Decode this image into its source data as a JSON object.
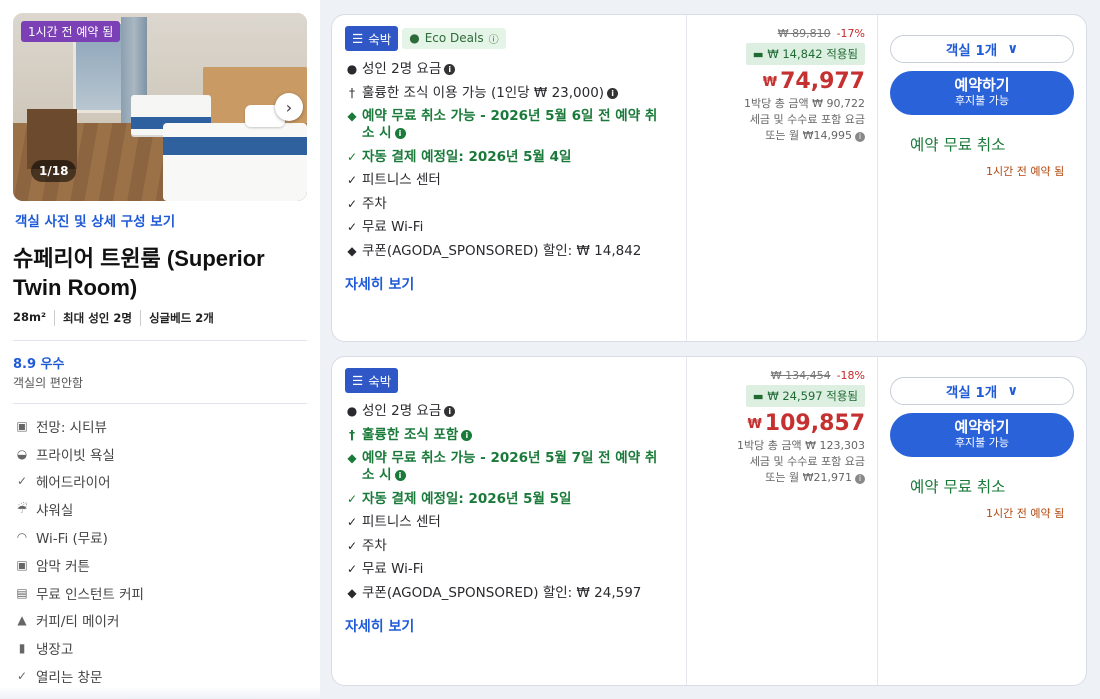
{
  "room": {
    "photo_badge": "1시간 전 예약 됨",
    "photo_counter": "1/18",
    "photo_link": "객실 사진 및 상세 구성 보기",
    "title": "슈페리어 트윈룸 (Superior Twin Room)",
    "specs": [
      "28m²",
      "최대 성인 2명",
      "싱글베드 2개"
    ],
    "rating": "8.9 우수",
    "rating_sub": "객실의 편안함",
    "amenities": [
      {
        "icon": "view-icon",
        "label": "전망: 시티뷰"
      },
      {
        "icon": "bathroom-icon",
        "label": "프라이빗 욕실"
      },
      {
        "icon": "check-icon",
        "label": "헤어드라이어"
      },
      {
        "icon": "shower-icon",
        "label": "샤워실"
      },
      {
        "icon": "wifi-icon",
        "label": "Wi-Fi (무료)"
      },
      {
        "icon": "curtain-icon",
        "label": "암막 커튼"
      },
      {
        "icon": "coffee-icon",
        "label": "무료 인스턴트 커피"
      },
      {
        "icon": "kettle-icon",
        "label": "커피/티 메이커"
      },
      {
        "icon": "fridge-icon",
        "label": "냉장고"
      },
      {
        "icon": "check-icon",
        "label": "열리는 창문"
      }
    ]
  },
  "offers": [
    {
      "tag_stay": "숙박",
      "tag_eco": "Eco Deals",
      "features": [
        {
          "icon": "person-icon",
          "text": "성인 2명 요금",
          "green": false,
          "info": true
        },
        {
          "icon": "fork-icon",
          "text": "훌륭한 조식 이용 가능 (1인당 ₩ 23,000)",
          "green": false,
          "info": true
        },
        {
          "icon": "shield-icon",
          "text": "예약 무료 취소 가능 - 2026년 5월 6일 전 예약 취소 시",
          "green": true,
          "info": true
        },
        {
          "icon": "check-icon",
          "text": "자동 결제 예정일: 2026년 5월 4일",
          "green": true,
          "info": false
        },
        {
          "icon": "check-icon",
          "text": "피트니스 센터",
          "green": false,
          "info": false
        },
        {
          "icon": "check-icon",
          "text": "주차",
          "green": false,
          "info": false
        },
        {
          "icon": "check-icon",
          "text": "무료 Wi-Fi",
          "green": false,
          "info": false
        },
        {
          "icon": "coupon-icon",
          "text": "쿠폰(AGODA_SPONSORED) 할인: ₩ 14,842",
          "green": false,
          "info": false
        }
      ],
      "more_link": "자세히 보기",
      "old_price": "₩ 89,810",
      "discount_pct": "-17%",
      "saved": "₩ 14,842 적용됨",
      "currency": "₩",
      "price": "74,977",
      "price_sub1": "1박당 총 금액 ₩ 90,722",
      "price_sub2": "세금 및 수수료 포함 요금",
      "price_sub3": "또는 월 ₩14,995",
      "room_select": "객실 1개",
      "book_label": "예약하기",
      "book_sub": "후지불 가능",
      "free_cancel": "예약 무료 취소",
      "urgency": "1시간 전 예약 됨"
    },
    {
      "tag_stay": "숙박",
      "features": [
        {
          "icon": "person-icon",
          "text": "성인 2명 요금",
          "green": false,
          "info": true
        },
        {
          "icon": "fork-icon",
          "text": "훌륭한 조식 포함",
          "green": true,
          "info": true
        },
        {
          "icon": "shield-icon",
          "text": "예약 무료 취소 가능 - 2026년 5월 7일 전 예약 취소 시",
          "green": true,
          "info": true
        },
        {
          "icon": "check-icon",
          "text": "자동 결제 예정일: 2026년 5월 5일",
          "green": true,
          "info": false
        },
        {
          "icon": "check-icon",
          "text": "피트니스 센터",
          "green": false,
          "info": false
        },
        {
          "icon": "check-icon",
          "text": "주차",
          "green": false,
          "info": false
        },
        {
          "icon": "check-icon",
          "text": "무료 Wi-Fi",
          "green": false,
          "info": false
        },
        {
          "icon": "coupon-icon",
          "text": "쿠폰(AGODA_SPONSORED) 할인: ₩ 24,597",
          "green": false,
          "info": false
        }
      ],
      "more_link": "자세히 보기",
      "old_price": "₩ 134,454",
      "discount_pct": "-18%",
      "saved": "₩ 24,597 적용됨",
      "currency": "₩",
      "price": "109,857",
      "price_sub1": "1박당 총 금액 ₩ 123,303",
      "price_sub2": "세금 및 수수료 포함 요금",
      "price_sub3": "또는 월 ₩21,971",
      "room_select": "객실 1개",
      "book_label": "예약하기",
      "book_sub": "후지불 가능",
      "free_cancel": "예약 무료 취소",
      "urgency": "1시간 전 예약 됨"
    }
  ]
}
